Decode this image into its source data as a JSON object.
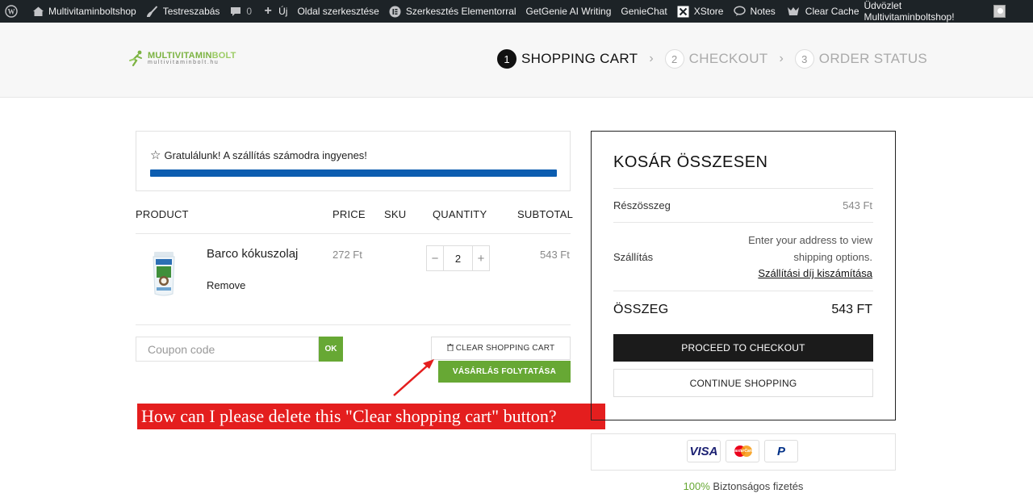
{
  "admin_bar": {
    "items": [
      {
        "icon": "wordpress-icon",
        "label": ""
      },
      {
        "icon": "home-icon",
        "label": "Multivitaminboltshop"
      },
      {
        "icon": "brush-icon",
        "label": "Testreszabás"
      },
      {
        "icon": "comment-icon",
        "label": "0"
      },
      {
        "icon": "plus-icon",
        "label": "Új"
      },
      {
        "icon": "",
        "label": "Oldal szerkesztése"
      },
      {
        "icon": "elementor-icon",
        "label": "Szerkesztés Elementorral"
      },
      {
        "icon": "",
        "label": "GetGenie AI Writing"
      },
      {
        "icon": "",
        "label": "GenieChat"
      },
      {
        "icon": "x-icon",
        "label": "XStore"
      },
      {
        "icon": "notes-icon",
        "label": "Notes"
      },
      {
        "icon": "cache-icon",
        "label": "Clear Cache"
      }
    ],
    "greeting": "Üdvözlet Multivitaminboltshop!"
  },
  "header": {
    "logo_main": "MULTIVITAMIN",
    "logo_bolt": "BOLT",
    "logo_sub": "multivitaminbolt.hu",
    "steps": [
      {
        "num": "1",
        "label": "SHOPPING CART",
        "active": true
      },
      {
        "num": "2",
        "label": "CHECKOUT",
        "active": false
      },
      {
        "num": "3",
        "label": "ORDER STATUS",
        "active": false
      }
    ],
    "step_separator": "›"
  },
  "shipping_notice": {
    "message": "Gratulálunk! A szállítás számodra ingyenes!",
    "progress": 1.0
  },
  "cart": {
    "headers": {
      "product": "PRODUCT",
      "price": "PRICE",
      "sku": "SKU",
      "quantity": "QUANTITY",
      "subtotal": "SUBTOTAL"
    },
    "items": [
      {
        "name": "Barco kókuszolaj",
        "remove": "Remove",
        "price": "272 Ft",
        "quantity": "2",
        "subtotal": "543 Ft"
      }
    ],
    "coupon_placeholder": "Coupon code",
    "ok_label": "OK",
    "clear_label": "CLEAR SHOPPING CART",
    "continue_label": "VÁSÁRLÁS FOLYTATÁSA"
  },
  "annotation": "How can I please delete this \"Clear shopping cart\" button?",
  "totals": {
    "title": "KOSÁR ÖSSZESEN",
    "subtotal_label": "Részösszeg",
    "subtotal_value": "543 Ft",
    "shipping_label": "Szállítás",
    "shipping_info": "Enter your address to view shipping options.",
    "shipping_link": "Szállítási díj kiszámítása",
    "total_label": "ÖSSZEG",
    "total_value": "543 FT",
    "checkout_label": "PROCEED TO CHECKOUT",
    "continue_label": "CONTINUE SHOPPING"
  },
  "payments": {
    "visa": "VISA",
    "mastercard": "MasterCard",
    "paypal": "P"
  },
  "secure": {
    "pct": "100%",
    "text": " Biztonságos fizetés"
  }
}
